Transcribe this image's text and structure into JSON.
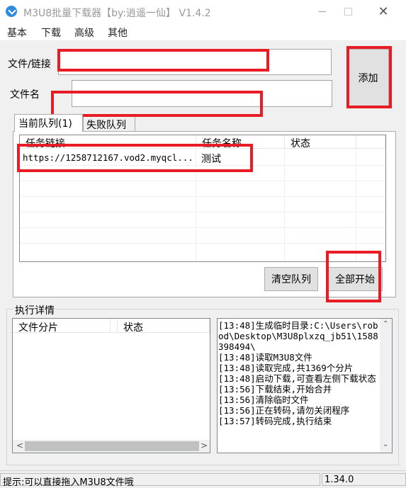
{
  "window": {
    "title": "M3U8批量下载器【by:逍遥一仙】 V1.4.2",
    "controls": {
      "minimize": "minimize-icon",
      "maximize": "maximize-icon",
      "close": "close-icon"
    }
  },
  "menu": [
    "基本",
    "下载",
    "高级",
    "其他"
  ],
  "form": {
    "url_label": "文件/链接",
    "url_value": "",
    "name_label": "文件名",
    "name_value": "",
    "add_button": "添加"
  },
  "tabs": [
    "当前队列(1)",
    "失败队列"
  ],
  "queue": {
    "columns": [
      "任务链接",
      "任务名称",
      "状态"
    ],
    "rows": [
      {
        "link": "https://1258712167.vod2.myqcl...",
        "name": "测试",
        "status": ""
      }
    ]
  },
  "buttons": {
    "clear": "清空队列",
    "start_all": "全部开始"
  },
  "details": {
    "title": "执行详情",
    "columns": [
      "文件分片",
      "状态"
    ],
    "log": [
      "[13:48]生成临时目录:C:\\Users\\robod\\Desktop\\M3U8plxzq_jb51\\1588398494\\",
      "[13:48]读取M3U8文件",
      "[13:48]读取完成,共1369个分片",
      "[13:48]启动下载,可查看左侧下载状态",
      "[13:56]下载结束,开始合并",
      "[13:56]清除临时文件",
      "[13:56]正在转码,请勿关闭程序",
      "[13:57]转码完成,执行结束"
    ]
  },
  "statusbar": {
    "hint": "提示:可以直接拖入M3U8文件哦",
    "version": "1.34.0"
  },
  "colors": {
    "highlight": "#e81c24",
    "titlebar": "#ffffff",
    "window": "#f0f0f0"
  }
}
